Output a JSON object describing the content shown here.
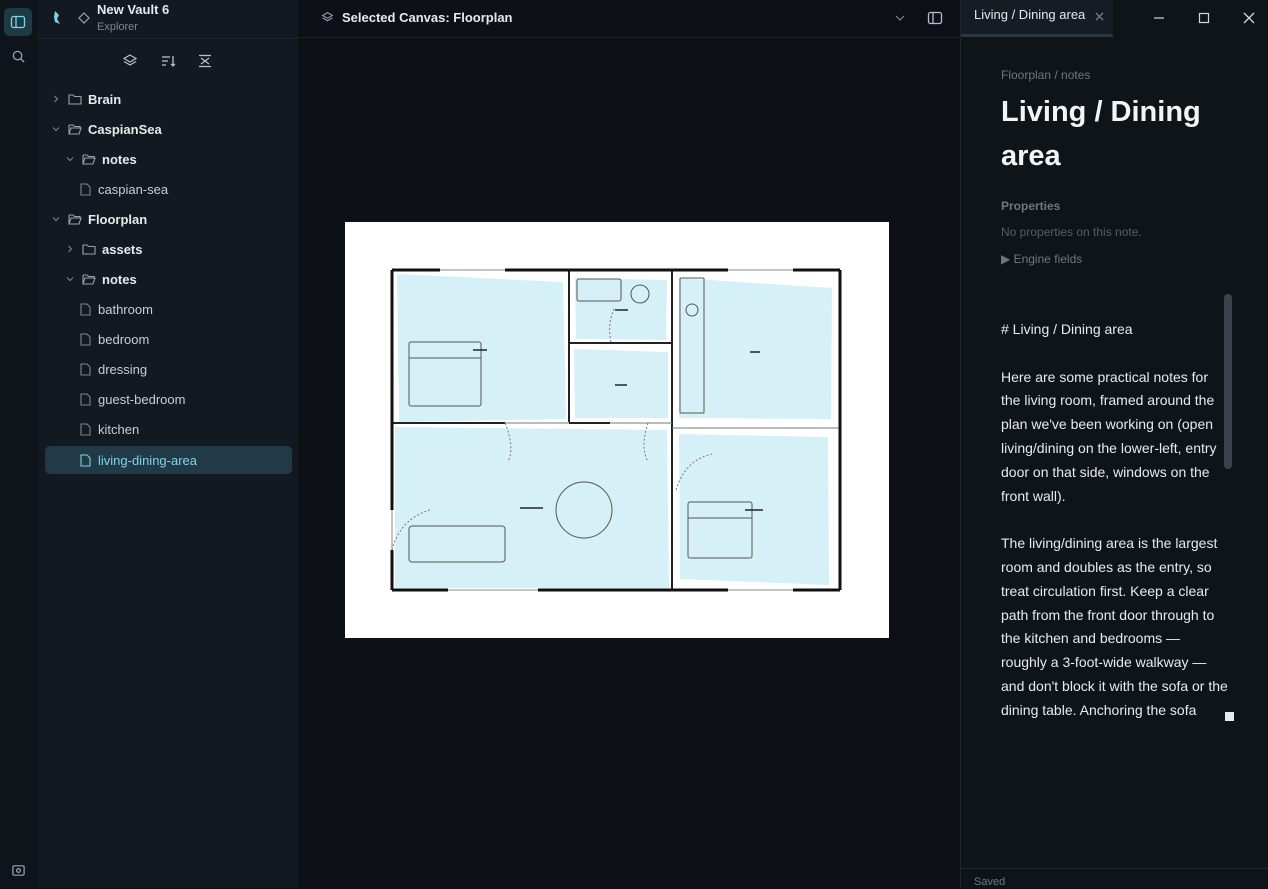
{
  "vault": {
    "name": "New Vault 6",
    "subtitle": "Explorer"
  },
  "explorer": {
    "tools": [
      "layers-icon",
      "sort-icon",
      "collapse-all-icon"
    ],
    "tree": [
      {
        "label": "Brain",
        "type": "folder",
        "expanded": false
      },
      {
        "label": "CaspianSea",
        "type": "folder",
        "expanded": true
      },
      {
        "label": "notes",
        "type": "folder",
        "expanded": true
      },
      {
        "label": "caspian-sea",
        "type": "file"
      },
      {
        "label": "Floorplan",
        "type": "folder",
        "expanded": true
      },
      {
        "label": "assets",
        "type": "folder",
        "expanded": false
      },
      {
        "label": "notes",
        "type": "folder",
        "expanded": true
      },
      {
        "label": "bathroom",
        "type": "file"
      },
      {
        "label": "bedroom",
        "type": "file"
      },
      {
        "label": "dressing",
        "type": "file"
      },
      {
        "label": "guest-bedroom",
        "type": "file"
      },
      {
        "label": "kitchen",
        "type": "file"
      },
      {
        "label": "living-dining-area",
        "type": "file",
        "active": true
      }
    ]
  },
  "canvas": {
    "title": "Selected Canvas: Floorplan"
  },
  "note": {
    "tab_label": "Living / Dining area",
    "breadcrumb": "Floorplan / notes",
    "title": "Living / Dining area",
    "properties_label": "Properties",
    "properties_empty": "No properties on this note.",
    "engine_fields": "▶ Engine fields",
    "heading_line": "# Living / Dining area",
    "paragraph1": "Here are some practical notes for the living room, framed around the plan we've been working on (open living/dining on the lower-left, entry door on that side, windows on the front wall).",
    "paragraph2": "The living/dining area is the largest room and doubles as the entry, so treat circulation first. Keep a clear path from the front door through to the kitchen and bedrooms — roughly a 3-foot-wide walkway — and don't block it with the sofa or the dining table. Anchoring the sofa"
  },
  "status": {
    "text": "Saved"
  },
  "colors": {
    "accent": "#7fd3e6",
    "active_row": "#223a47",
    "room_fill": "#d6f0f8"
  }
}
